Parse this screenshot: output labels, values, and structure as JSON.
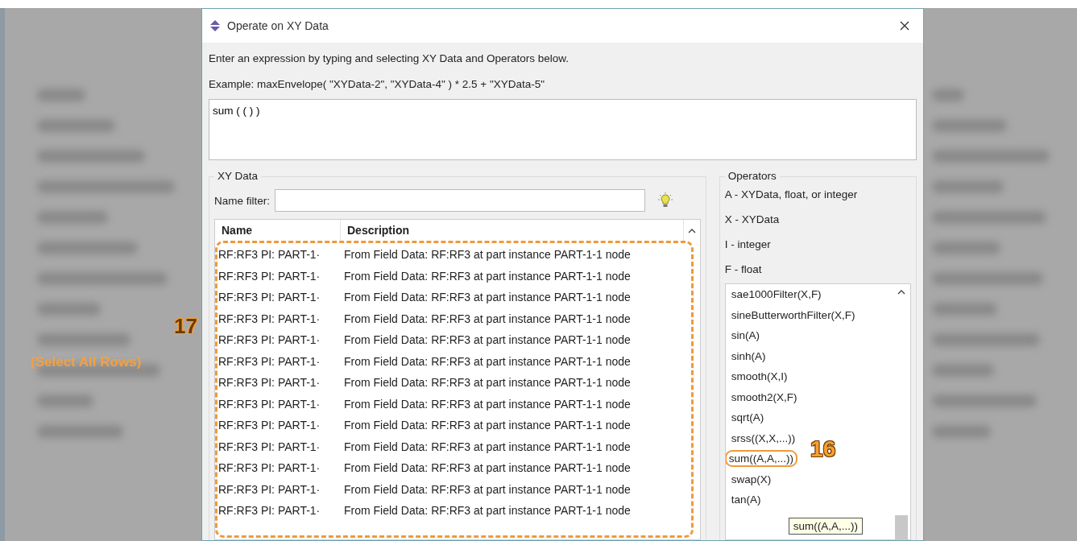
{
  "dialog": {
    "title": "Operate on XY Data",
    "instructions": "Enter an expression by typing and selecting XY Data and Operators below.",
    "example": "Example: maxEnvelope( \"XYData-2\", \"XYData-4\" ) * 2.5 + \"XYData-5\"",
    "expression": "sum ( ( ) )"
  },
  "xy_data": {
    "title": "XY Data",
    "filter_label": "Name filter:",
    "columns": [
      "Name",
      "Description"
    ],
    "rows": [
      {
        "name": "RF:RF3 PI: PART-1·",
        "description": "From Field Data: RF:RF3  at part instance PART-1-1 node"
      },
      {
        "name": "RF:RF3 PI: PART-1·",
        "description": "From Field Data: RF:RF3  at part instance PART-1-1 node"
      },
      {
        "name": "RF:RF3 PI: PART-1·",
        "description": "From Field Data: RF:RF3  at part instance PART-1-1 node"
      },
      {
        "name": "RF:RF3 PI: PART-1·",
        "description": "From Field Data: RF:RF3  at part instance PART-1-1 node"
      },
      {
        "name": "RF:RF3 PI: PART-1·",
        "description": "From Field Data: RF:RF3  at part instance PART-1-1 node"
      },
      {
        "name": "RF:RF3 PI: PART-1·",
        "description": "From Field Data: RF:RF3  at part instance PART-1-1 node"
      },
      {
        "name": "RF:RF3 PI: PART-1·",
        "description": "From Field Data: RF:RF3  at part instance PART-1-1 node"
      },
      {
        "name": "RF:RF3 PI: PART-1·",
        "description": "From Field Data: RF:RF3  at part instance PART-1-1 node"
      },
      {
        "name": "RF:RF3 PI: PART-1·",
        "description": "From Field Data: RF:RF3  at part instance PART-1-1 node"
      },
      {
        "name": "RF:RF3 PI: PART-1·",
        "description": "From Field Data: RF:RF3  at part instance PART-1-1 node"
      },
      {
        "name": "RF:RF3 PI: PART-1·",
        "description": "From Field Data: RF:RF3  at part instance PART-1-1 node"
      },
      {
        "name": "RF:RF3 PI: PART-1·",
        "description": "From Field Data: RF:RF3  at part instance PART-1-1 node"
      },
      {
        "name": "RF:RF3 PI: PART-1·",
        "description": "From Field Data: RF:RF3  at part instance PART-1-1 node"
      }
    ]
  },
  "operators": {
    "title": "Operators",
    "legend": [
      "A - XYData, float, or integer",
      "X - XYData",
      "I - integer",
      "F - float"
    ],
    "items": [
      {
        "label": "sae1000Filter(X,F)",
        "highlighted": false
      },
      {
        "label": "sineButterworthFilter(X,F)",
        "highlighted": false
      },
      {
        "label": "sin(A)",
        "highlighted": false
      },
      {
        "label": "sinh(A)",
        "highlighted": false
      },
      {
        "label": "smooth(X,I)",
        "highlighted": false
      },
      {
        "label": "smooth2(X,F)",
        "highlighted": false
      },
      {
        "label": "sqrt(A)",
        "highlighted": false
      },
      {
        "label": "srss((X,X,...))",
        "highlighted": false
      },
      {
        "label": "sum((A,A,...))",
        "highlighted": true
      },
      {
        "label": "swap(X)",
        "highlighted": false
      },
      {
        "label": "tan(A)",
        "highlighted": false
      }
    ],
    "tooltip": "sum((A,A,...))"
  },
  "row_callout": {
    "number": "17",
    "caption": "(Select All Rows)"
  },
  "operator_callout": {
    "number": "16"
  }
}
